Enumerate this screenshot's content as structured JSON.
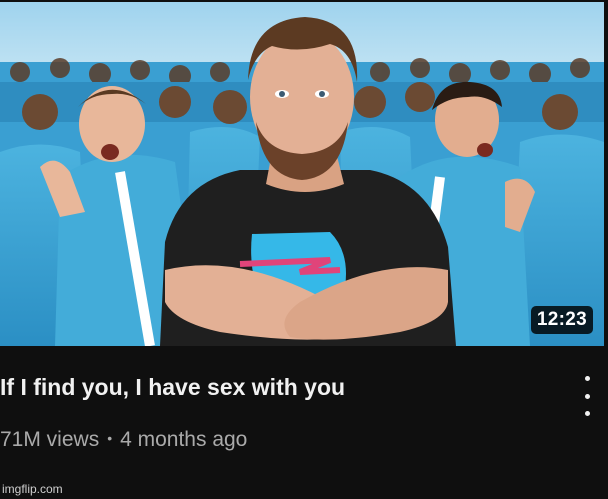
{
  "video": {
    "title": "If I find you, I have sex with you",
    "duration": "12:23",
    "views": "71M views",
    "separator": "•",
    "age": "4 months ago"
  },
  "thumbnail": {
    "sky_color": "#bfe3f3",
    "tracksuit_color": "#3aa6d6",
    "shirt_color": "#1f1f1f",
    "logo_color": "#35b8e8"
  },
  "icons": {
    "more": "more-vertical-icon"
  },
  "watermark": "imgflip.com"
}
